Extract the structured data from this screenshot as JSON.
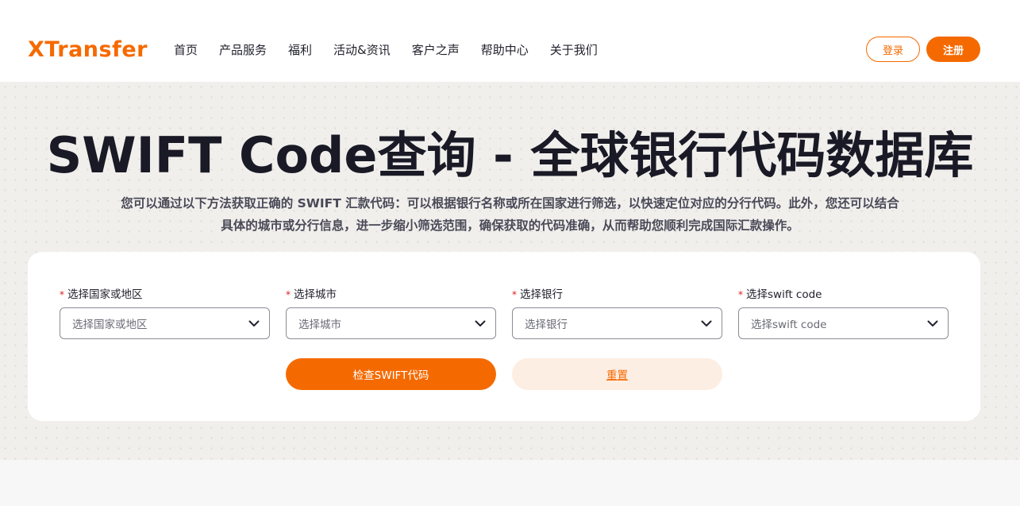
{
  "brand": {
    "logo_text": "XTransfer",
    "accent": "#f56a00"
  },
  "nav": {
    "items": [
      "首页",
      "产品服务",
      "福利",
      "活动&资讯",
      "客户之声",
      "帮助中心",
      "关于我们"
    ]
  },
  "auth": {
    "login_label": "登录",
    "register_label": "注册"
  },
  "hero": {
    "title": "SWIFT Code查询 - 全球银行代码数据库",
    "description": "您可以通过以下方法获取正确的 SWIFT 汇款代码：可以根据银行名称或所在国家进行筛选，以快速定位对应的分行代码。此外，您还可以结合具体的城市或分行信息，进一步缩小筛选范围，确保获取的代码准确，从而帮助您顺利完成国际汇款操作。"
  },
  "form": {
    "required_mark": "*",
    "fields": [
      {
        "label": "选择国家或地区",
        "placeholder": "选择国家或地区"
      },
      {
        "label": "选择城市",
        "placeholder": "选择城市"
      },
      {
        "label": "选择银行",
        "placeholder": "选择银行"
      },
      {
        "label": "选择swift code",
        "placeholder": "选择swift code"
      }
    ],
    "submit_label": "检查SWIFT代码",
    "reset_label": "重置",
    "chevron_icon": "chevron-down-icon"
  }
}
